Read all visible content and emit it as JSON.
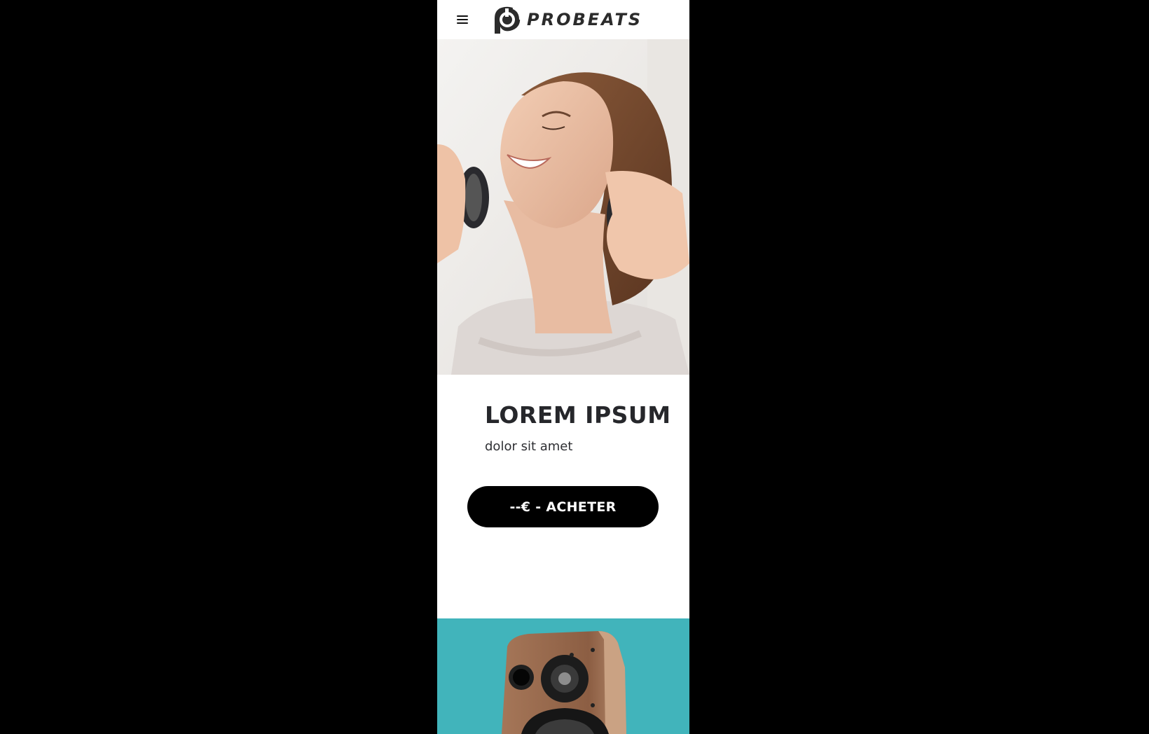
{
  "header": {
    "brand": "PROBEATS",
    "menu_icon": "hamburger-menu-icon",
    "logo_icon": "headphone-p-logo-icon"
  },
  "hero": {
    "image": "woman-wearing-headphones-photo"
  },
  "product": {
    "title": "LOREM IPSUM",
    "subtitle": "dolor sit amet",
    "buy_label": "--€ - ACHETER"
  },
  "next_section": {
    "image": "wooden-bookshelf-speaker-photo",
    "background_color": "#41b4bb"
  },
  "colors": {
    "page_background": "#000000",
    "button": "#000000",
    "accent": "#41b4bb"
  }
}
